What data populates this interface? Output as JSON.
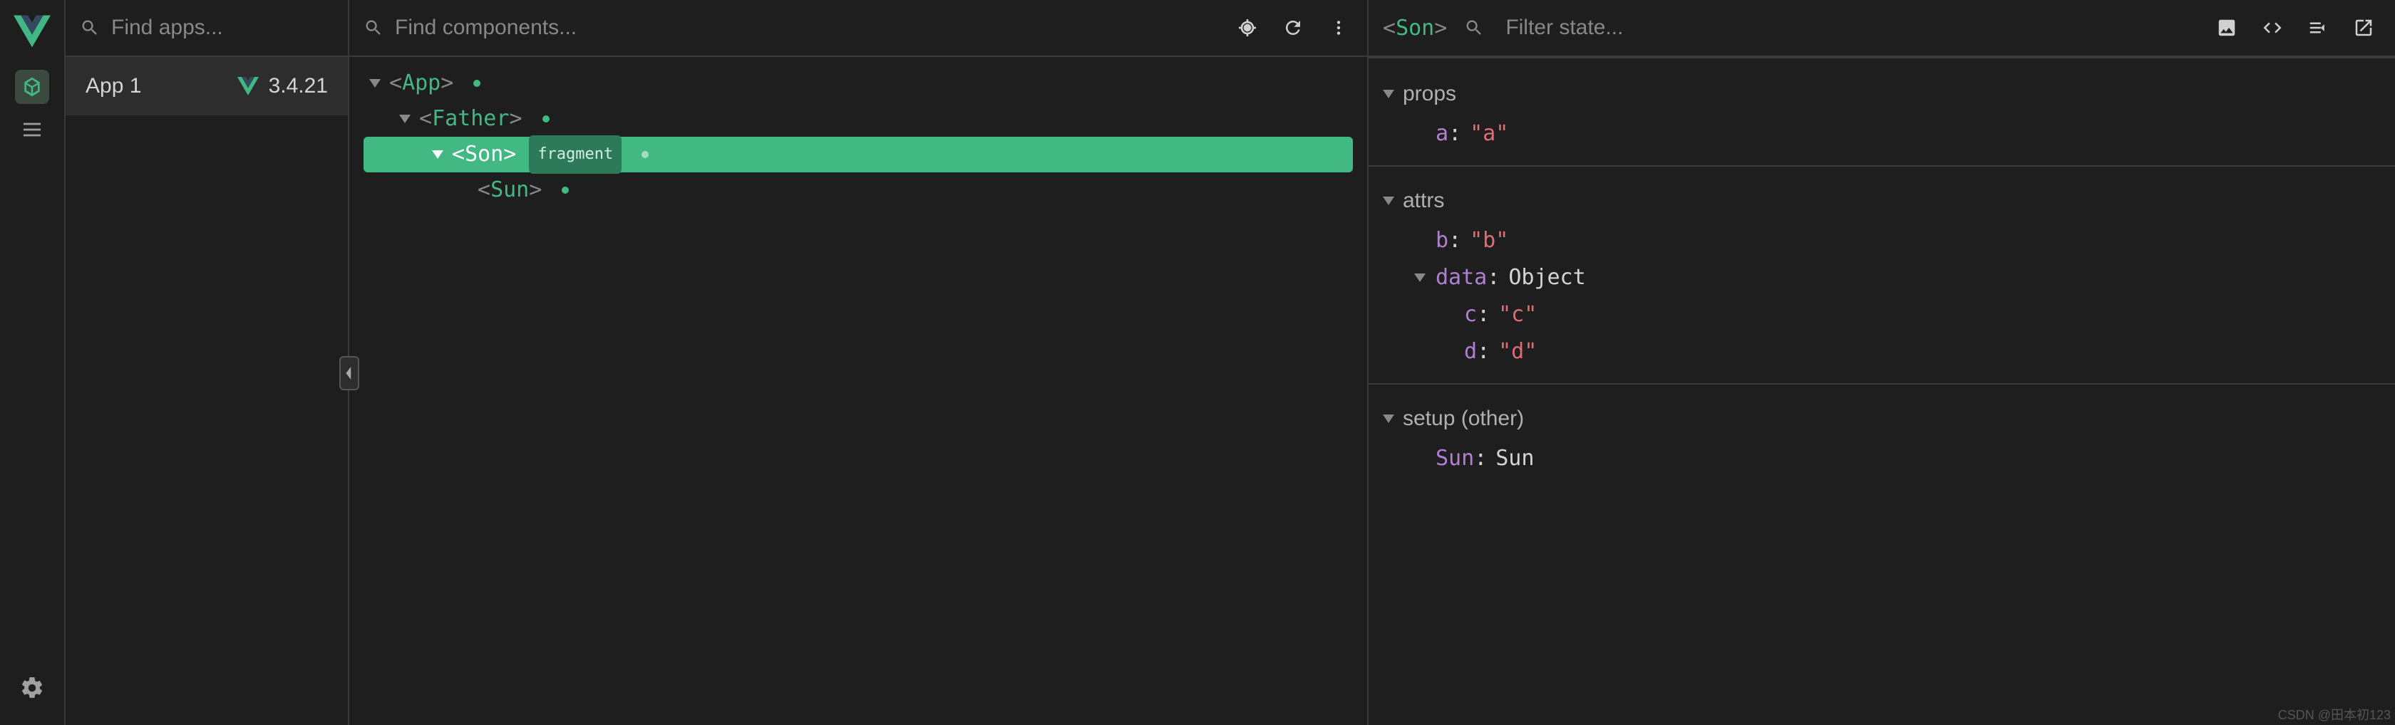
{
  "leftRail": {
    "tooltip_components": "Components",
    "tooltip_timeline": "Timeline"
  },
  "appsSearch": {
    "placeholder": "Find apps..."
  },
  "apps": [
    {
      "name": "App 1",
      "version": "3.4.21"
    }
  ],
  "treeSearch": {
    "placeholder": "Find components..."
  },
  "tree": {
    "root": {
      "name": "App"
    },
    "l1": {
      "name": "Father"
    },
    "l2": {
      "name": "Son",
      "badge": "fragment"
    },
    "l3": {
      "name": "Sun"
    }
  },
  "state": {
    "selected": "Son",
    "filterPlaceholder": "Filter state...",
    "sections": {
      "props": {
        "label": "props",
        "rows": [
          {
            "key": "a",
            "value": "\"a\""
          }
        ]
      },
      "attrs": {
        "label": "attrs",
        "rows": [
          {
            "key": "b",
            "value": "\"b\""
          },
          {
            "key": "data",
            "value": "Object",
            "type": "obj",
            "children": [
              {
                "key": "c",
                "value": "\"c\""
              },
              {
                "key": "d",
                "value": "\"d\""
              }
            ]
          }
        ]
      },
      "setup": {
        "label": "setup (other)",
        "rows": [
          {
            "key": "Sun",
            "value": "Sun",
            "plain": true
          }
        ]
      }
    }
  },
  "watermark": "CSDN @田本初123"
}
